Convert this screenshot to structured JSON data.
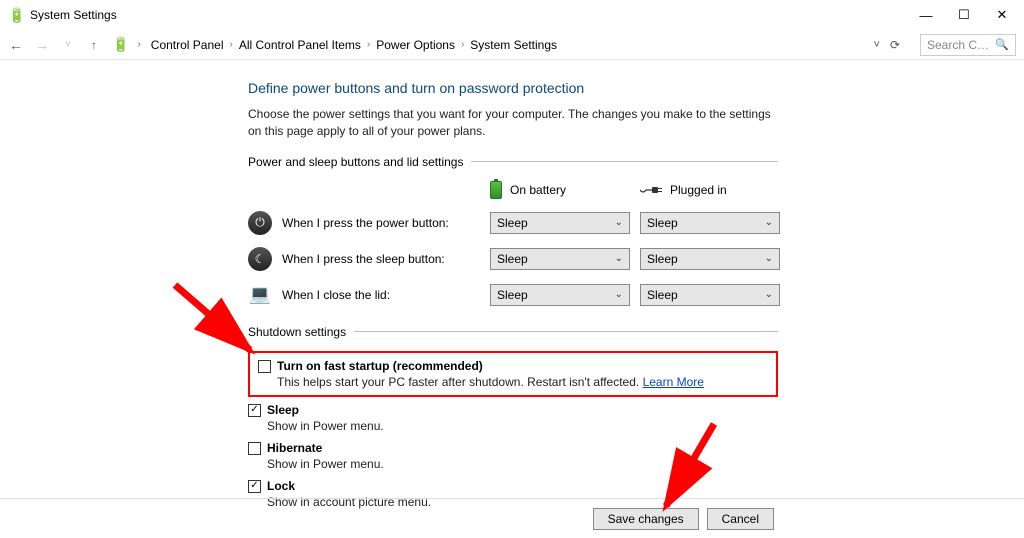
{
  "window": {
    "title": "System Settings"
  },
  "breadcrumb": [
    "Control Panel",
    "All Control Panel Items",
    "Power Options",
    "System Settings"
  ],
  "search": {
    "placeholder": "Search Co..."
  },
  "heading": "Define power buttons and turn on password protection",
  "description": "Choose the power settings that you want for your computer. The changes you make to the settings on this page apply to all of your power plans.",
  "section1": {
    "title": "Power and sleep buttons and lid settings",
    "columns": {
      "battery": "On battery",
      "plugged": "Plugged in"
    },
    "rows": [
      {
        "label": "When I press the power button:",
        "battery": "Sleep",
        "plugged": "Sleep"
      },
      {
        "label": "When I press the sleep button:",
        "battery": "Sleep",
        "plugged": "Sleep"
      },
      {
        "label": "When I close the lid:",
        "battery": "Sleep",
        "plugged": "Sleep"
      }
    ]
  },
  "section2": {
    "title": "Shutdown settings",
    "fast_startup": {
      "label": "Turn on fast startup (recommended)",
      "checked": false,
      "desc": "This helps start your PC faster after shutdown. Restart isn't affected. ",
      "learn": "Learn More"
    },
    "sleep": {
      "label": "Sleep",
      "checked": true,
      "desc": "Show in Power menu."
    },
    "hibernate": {
      "label": "Hibernate",
      "checked": false,
      "desc": "Show in Power menu."
    },
    "lock": {
      "label": "Lock",
      "checked": true,
      "desc": "Show in account picture menu."
    }
  },
  "buttons": {
    "save": "Save changes",
    "cancel": "Cancel"
  }
}
